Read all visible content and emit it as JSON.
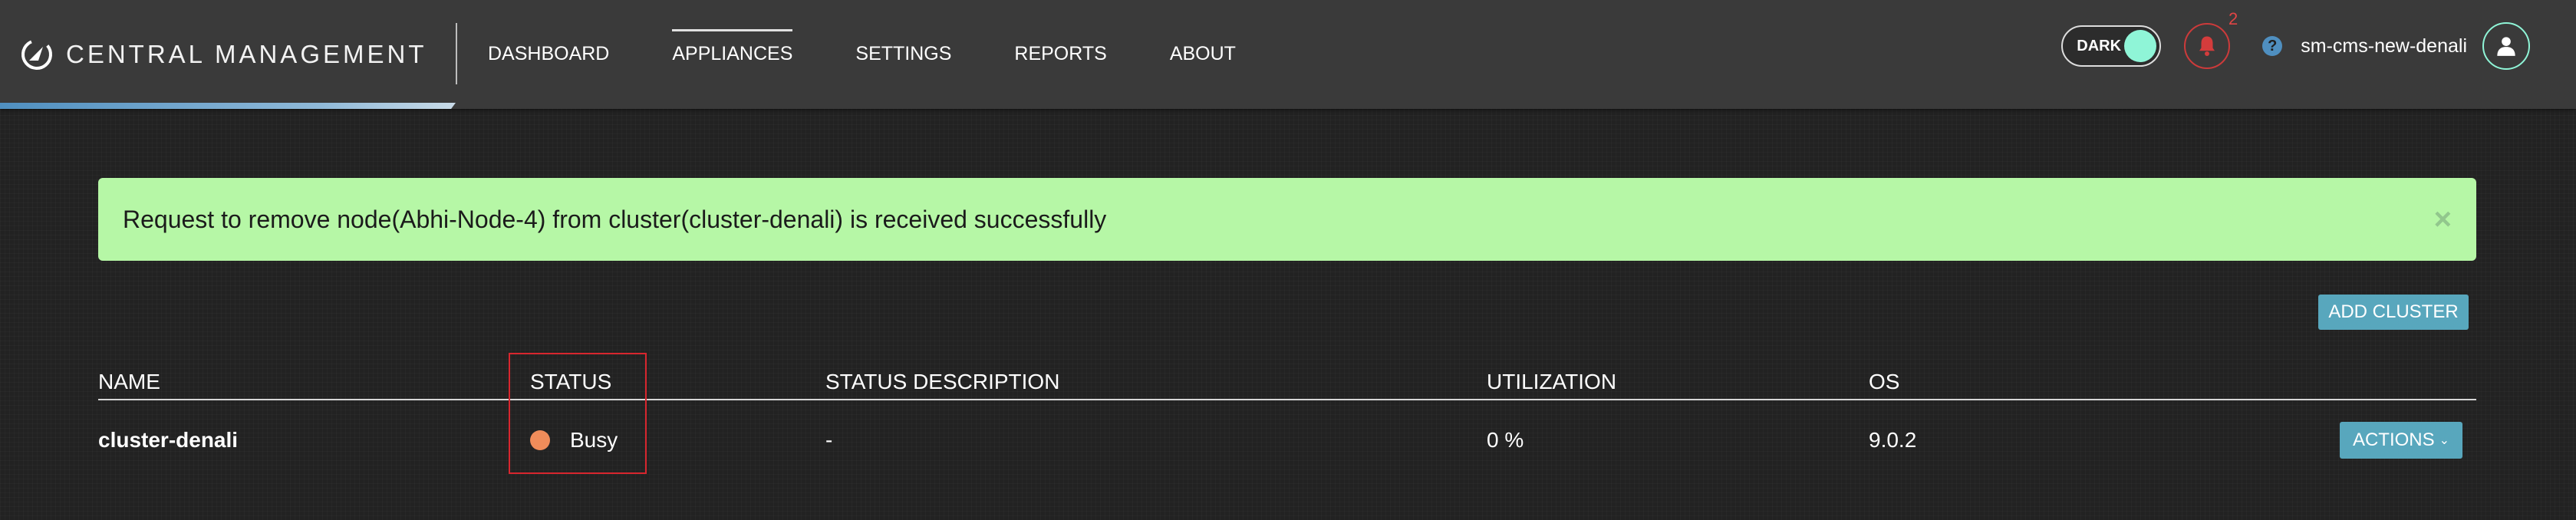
{
  "header": {
    "brand_title": "CENTRAL MANAGEMENT",
    "nav": [
      {
        "label": "DASHBOARD",
        "active": false
      },
      {
        "label": "APPLIANCES",
        "active": true
      },
      {
        "label": "SETTINGS",
        "active": false
      },
      {
        "label": "REPORTS",
        "active": false
      },
      {
        "label": "ABOUT",
        "active": false
      }
    ],
    "theme_toggle_label": "DARK",
    "notification_count": "2",
    "help_symbol": "?",
    "username": "sm-cms-new-denali",
    "icons": {
      "logo": "brand-logo-icon",
      "bell": "bell-icon",
      "help": "help-icon",
      "user": "user-icon"
    }
  },
  "alert": {
    "message": "Request to remove node(Abhi-Node-4) from cluster(cluster-denali) is received successfully",
    "close_symbol": "×"
  },
  "toolbar": {
    "add_cluster_label": "ADD CLUSTER"
  },
  "table": {
    "columns": [
      "NAME",
      "STATUS",
      "STATUS DESCRIPTION",
      "UTILIZATION",
      "OS"
    ],
    "rows": [
      {
        "name": "cluster-denali",
        "status": "Busy",
        "status_description": "-",
        "utilization": "0 %",
        "os": "9.0.2",
        "actions_label": "ACTIONS"
      }
    ]
  },
  "colors": {
    "header_bg": "#3a3a3a",
    "page_bg": "#222222",
    "alert_bg": "#b6f7a6",
    "button_teal": "#58a7bd",
    "status_busy": "#ef8c5a",
    "toggle_knob": "#8ff5d7",
    "highlight_red": "#d8262e"
  }
}
